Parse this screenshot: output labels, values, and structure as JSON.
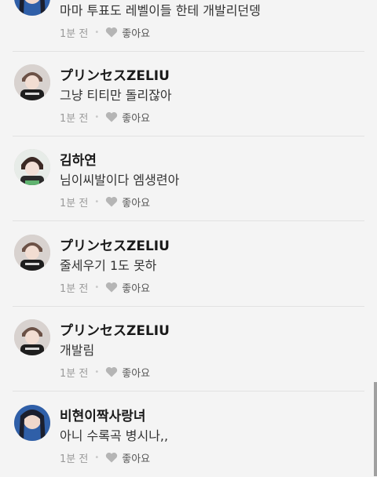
{
  "comments": [
    {
      "author": "",
      "text": "마마 투표도 레벨이들 한테 개발리던뎅",
      "time": "1분 전",
      "like_label": "좋아요",
      "avatar": "blue-girl"
    },
    {
      "author": "プリンセスZELIU",
      "text": "그냥 티티만 돌리잖아",
      "time": "1분 전",
      "like_label": "좋아요",
      "avatar": "boy-black"
    },
    {
      "author": "김하연",
      "text": "님이씨발이다 엠생련아",
      "time": "1분 전",
      "like_label": "좋아요",
      "avatar": "boy-green"
    },
    {
      "author": "プリンセスZELIU",
      "text": "줄세우기 1도 못하",
      "time": "1분 전",
      "like_label": "좋아요",
      "avatar": "boy-black"
    },
    {
      "author": "プリンセスZELIU",
      "text": "개발림",
      "time": "1분 전",
      "like_label": "좋아요",
      "avatar": "boy-black"
    },
    {
      "author": "비현이짝사랑녀",
      "text": "아니 수록곡 병시나,,",
      "time": "1분 전",
      "like_label": "좋아요",
      "avatar": "blue-girl"
    }
  ]
}
